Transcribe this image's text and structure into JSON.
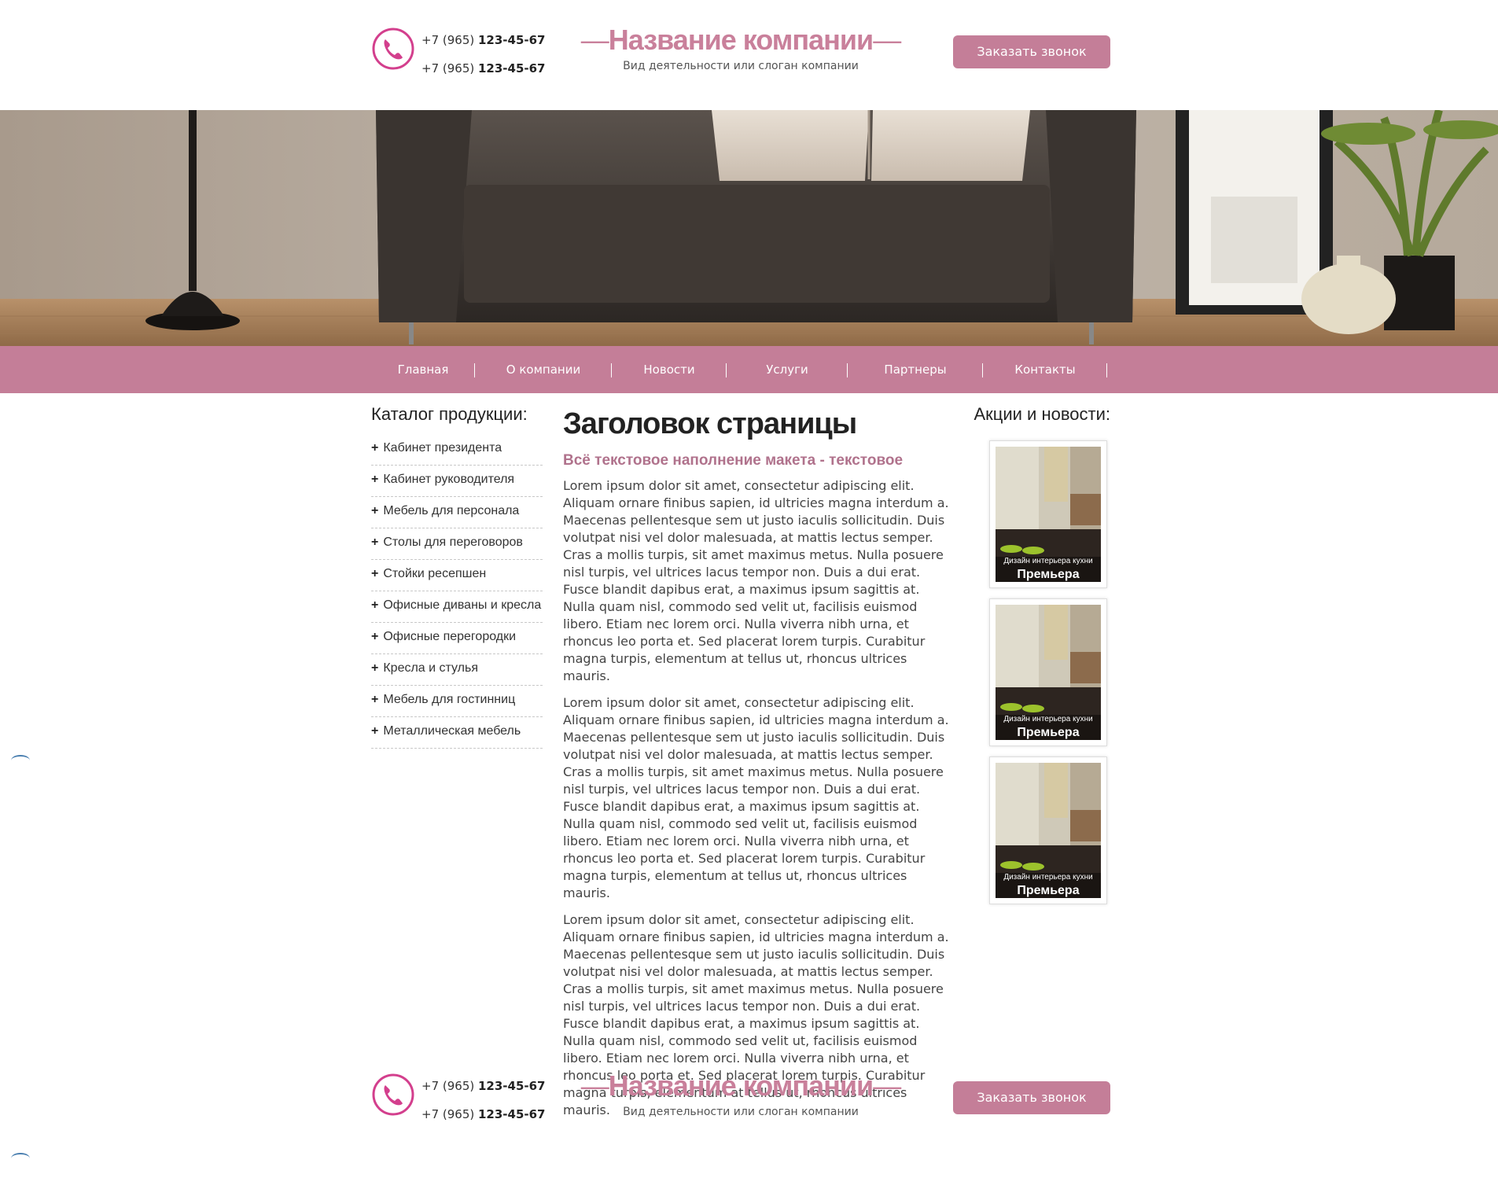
{
  "header": {
    "phones": [
      {
        "prefix": "+7 (965) ",
        "number": "123-45-67"
      },
      {
        "prefix": "+7 (965) ",
        "number": "123-45-67"
      }
    ],
    "company_name": "Название компании",
    "dash": "—",
    "slogan": "Вид деятельности или слоган компании",
    "call_button": "Заказать звонок"
  },
  "nav": {
    "items": [
      "Главная",
      "О компании",
      "Новости",
      "Услуги",
      "Партнеры",
      "Контакты"
    ]
  },
  "sidebar": {
    "title": "Каталог продукции:",
    "items": [
      "Кабинет президента",
      "Кабинет руководителя",
      "Мебель для персонала",
      "Столы для переговоров",
      "Стойки ресепшен",
      "Офисные диваны и кресла",
      "Офисные перегородки",
      "Кресла и стулья",
      "Мебель для гостинниц",
      "Металлическая мебель"
    ],
    "bullet": "+"
  },
  "main": {
    "title": "Заголовок страницы",
    "subtitle": "Всё текстовое наполнение макета - текстовое",
    "paragraphs": [
      "Lorem ipsum dolor sit amet, consectetur adipiscing elit. Aliquam ornare finibus sapien, id ultricies magna interdum a. Maecenas pellentesque sem ut justo iaculis sollicitudin. Duis volutpat nisi vel dolor malesuada, at mattis lectus semper. Cras a mollis turpis, sit amet maximus metus. Nulla posuere nisl turpis, vel ultrices lacus tempor non. Duis a dui erat. Fusce blandit dapibus erat, a maximus ipsum sagittis at. Nulla quam nisl, commodo sed velit ut, facilisis euismod libero. Etiam nec lorem orci. Nulla viverra nibh urna, et rhoncus leo porta et. Sed placerat lorem turpis. Curabitur magna turpis, elementum at tellus ut, rhoncus ultrices mauris.",
      "Lorem ipsum dolor sit amet, consectetur adipiscing elit. Aliquam ornare finibus sapien, id ultricies magna interdum a. Maecenas pellentesque sem ut justo iaculis sollicitudin. Duis volutpat nisi vel dolor malesuada, at mattis lectus semper. Cras a mollis turpis, sit amet maximus metus. Nulla posuere nisl turpis, vel ultrices lacus tempor non. Duis a dui erat. Fusce blandit dapibus erat, a maximus ipsum sagittis at. Nulla quam nisl, commodo sed velit ut, facilisis euismod libero. Etiam nec lorem orci. Nulla viverra nibh urna, et rhoncus leo porta et. Sed placerat lorem turpis. Curabitur magna turpis, elementum at tellus ut, rhoncus ultrices mauris.",
      "Lorem ipsum dolor sit amet, consectetur adipiscing elit. Aliquam ornare finibus sapien, id ultricies magna interdum a. Maecenas pellentesque sem ut justo iaculis sollicitudin. Duis volutpat nisi vel dolor malesuada, at mattis lectus semper. Cras a mollis turpis, sit amet maximus metus. Nulla posuere nisl turpis, vel ultrices lacus tempor non. Duis a dui erat. Fusce blandit dapibus erat, a maximus ipsum sagittis at. Nulla quam nisl, commodo sed velit ut, facilisis euismod libero. Etiam nec lorem orci. Nulla viverra nibh urna, et rhoncus leo porta et. Sed placerat lorem turpis. Curabitur magna turpis, elementum at tellus ut, rhoncus ultrices mauris."
    ]
  },
  "news": {
    "title": "Акции и новости:",
    "cards": [
      {
        "caption_small": "Дизайн интерьера кухни",
        "caption_big": "Премьера"
      },
      {
        "caption_small": "Дизайн интерьера кухни",
        "caption_big": "Премьера"
      },
      {
        "caption_small": "Дизайн интерьера кухни",
        "caption_big": "Премьера"
      }
    ]
  },
  "footer": {
    "phones": [
      {
        "prefix": "+7 (965) ",
        "number": "123-45-67"
      },
      {
        "prefix": "+7 (965) ",
        "number": "123-45-67"
      }
    ],
    "company_name": "Название компании",
    "dash": "—",
    "slogan": "Вид деятельности или слоган компании",
    "call_button": "Заказать звонок"
  },
  "colors": {
    "accent": "#c47e98",
    "brand_text": "#c9809b",
    "subtitle": "#b0728c"
  },
  "icons": {
    "phone": "phone-icon",
    "hero": "sofa-interior-photo",
    "news_image": "kitchen-photo"
  }
}
